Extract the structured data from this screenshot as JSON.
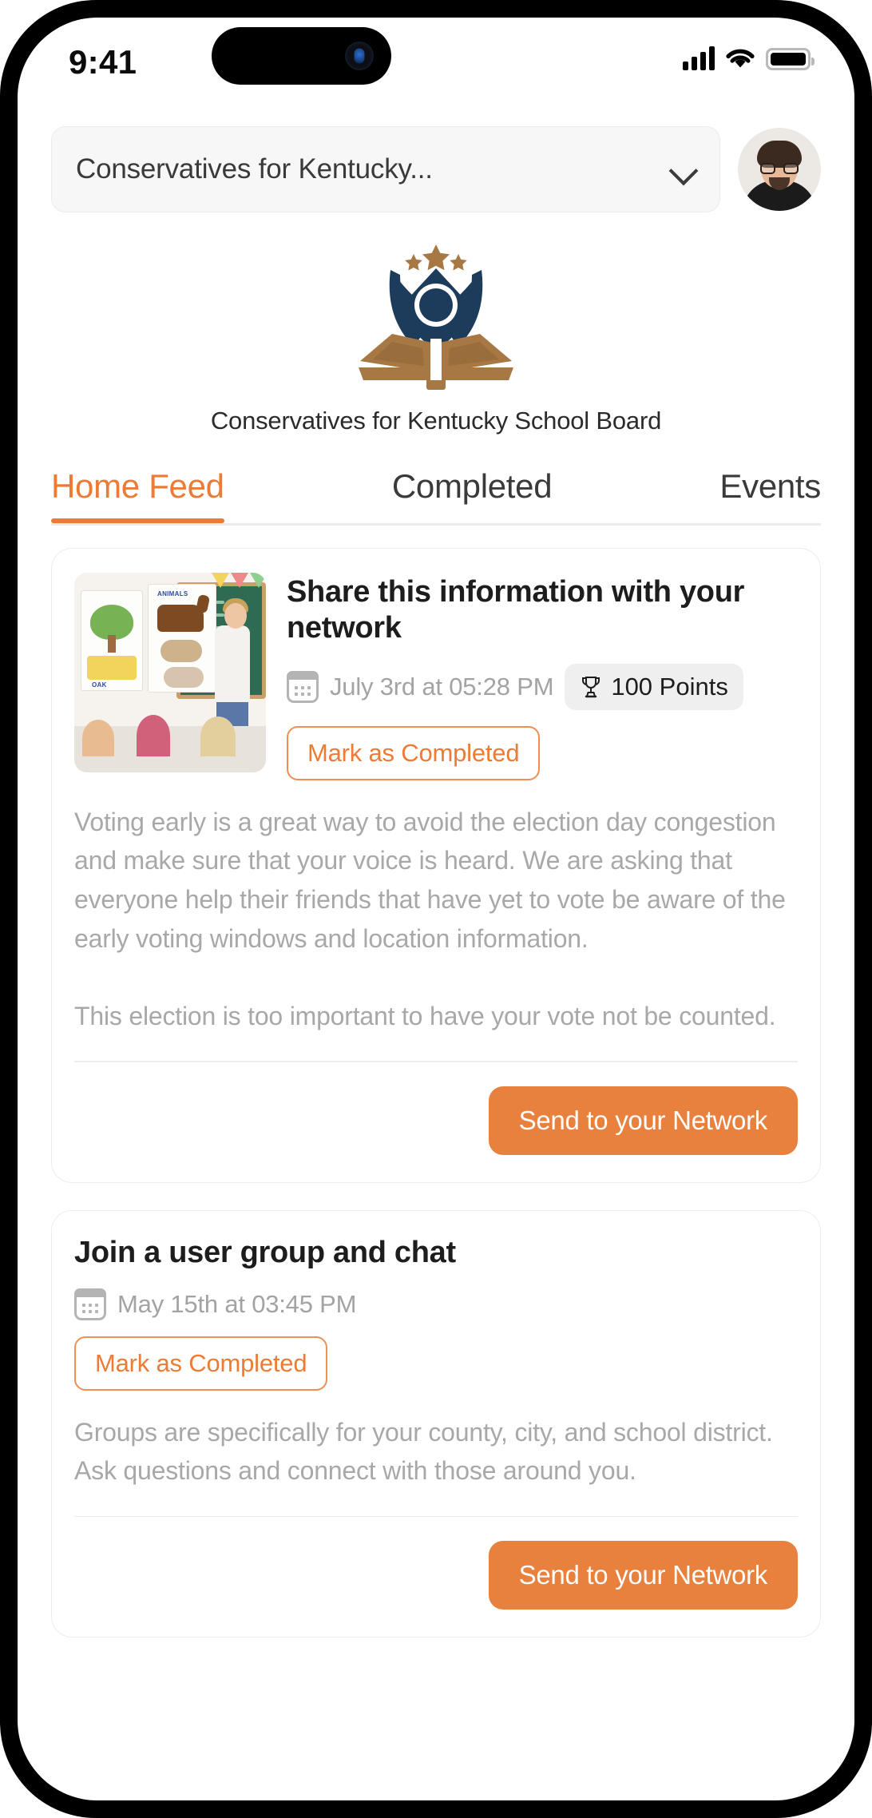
{
  "status_bar": {
    "time": "9:41",
    "signal_icon": "cellular-signal-icon",
    "wifi_icon": "wifi-icon",
    "battery_icon": "battery-full-icon"
  },
  "top_bar": {
    "org_selector_value": "Conservatives for Kentucky...",
    "chevron_icon": "chevron-down-icon",
    "avatar_icon": "user-avatar"
  },
  "branding": {
    "logo_icon": "school-board-logo",
    "org_name": "Conservatives for Kentucky School Board"
  },
  "tabs": [
    {
      "label": "Home Feed",
      "active": true
    },
    {
      "label": "Completed",
      "active": false
    },
    {
      "label": "Events",
      "active": false
    }
  ],
  "colors": {
    "accent_orange": "#ec7b35",
    "button_orange": "#e8803e",
    "logo_navy": "#1d3c5c",
    "logo_bronze": "#a87844",
    "text_dark": "#1d1d1d",
    "text_muted": "#a8a8a8"
  },
  "feed": {
    "cards": [
      {
        "title": "Share this information with your network",
        "date": "July 3rd at 05:28 PM",
        "calendar_icon": "calendar-icon",
        "points_icon": "trophy-icon",
        "points": "100 Points",
        "mark_label": "Mark as Completed",
        "body": "Voting early is a great way to avoid the election day congestion and make sure that your voice is heard. We are asking that everyone help their friends that have yet to vote be aware of the early voting windows and location information.\n\nThis election is too important to have your vote not be counted.",
        "send_label": "Send to your Network",
        "thumb_icon": "classroom-photo",
        "thumb_labels": {
          "animals": "ANIMALS",
          "oak": "OAK"
        }
      },
      {
        "title": "Join a user group and chat",
        "date": "May 15th at 03:45 PM",
        "calendar_icon": "calendar-icon",
        "mark_label": "Mark as Completed",
        "body": "Groups are specifically for your county, city, and school district. Ask questions and connect with those around you.",
        "send_label": "Send to your Network"
      }
    ]
  }
}
